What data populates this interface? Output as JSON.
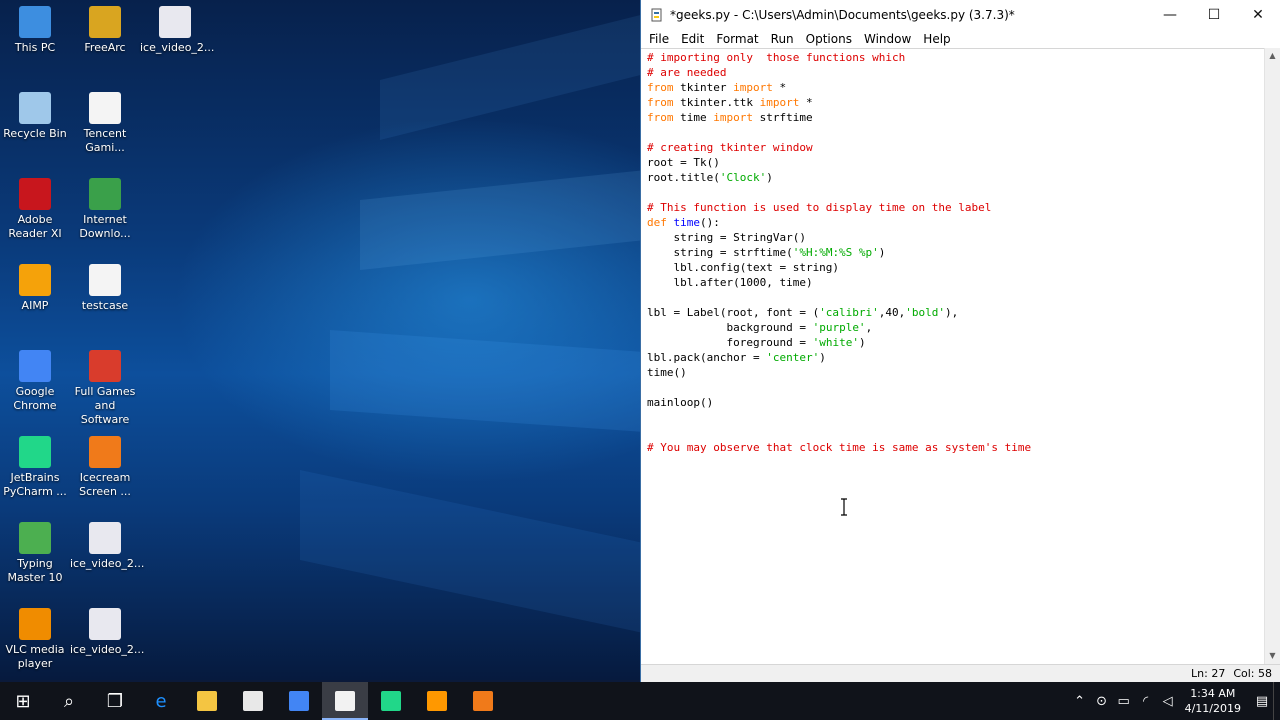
{
  "desktop": {
    "icons": [
      {
        "label": "This PC",
        "icon": "this-pc-icon",
        "color": "#3d8ee0"
      },
      {
        "label": "FreeArc",
        "icon": "freearc-icon",
        "color": "#d9a520"
      },
      {
        "label": "ice_video_2...",
        "icon": "video-file-icon",
        "color": "#e8e8ef"
      },
      {
        "label": "Recycle Bin",
        "icon": "recycle-bin-icon",
        "color": "#9fc8ea"
      },
      {
        "label": "Tencent Gami...",
        "icon": "document-shortcut-icon",
        "color": "#f4f4f4"
      },
      {
        "label": "Adobe Reader XI",
        "icon": "adobe-reader-icon",
        "color": "#c8161d"
      },
      {
        "label": "Internet Downlo...",
        "icon": "internet-download-icon",
        "color": "#3aa04a"
      },
      {
        "label": "AIMP",
        "icon": "aimp-icon",
        "color": "#f5a20a"
      },
      {
        "label": "testcase",
        "icon": "text-file-icon",
        "color": "#f4f4f4"
      },
      {
        "label": "Google Chrome",
        "icon": "chrome-icon",
        "color": "#4285f4"
      },
      {
        "label": "Full Games and Software",
        "icon": "full-games-icon",
        "color": "#d93c2c"
      },
      {
        "label": "JetBrains PyCharm ...",
        "icon": "pycharm-icon",
        "color": "#21d789"
      },
      {
        "label": "Icecream Screen ...",
        "icon": "icecream-icon",
        "color": "#f07a1a"
      },
      {
        "label": "Typing Master 10",
        "icon": "typing-master-icon",
        "color": "#4caf50"
      },
      {
        "label": "ice_video_2...",
        "icon": "video-file-icon",
        "color": "#e8e8ef"
      },
      {
        "label": "VLC media player",
        "icon": "vlc-icon",
        "color": "#f08c00"
      },
      {
        "label": "ice_video_2...",
        "icon": "video-file-icon",
        "color": "#e8e8ef"
      }
    ]
  },
  "window": {
    "title": "*geeks.py - C:\\Users\\Admin\\Documents\\geeks.py (3.7.3)*",
    "controls": {
      "minimize": "—",
      "maximize": "☐",
      "close": "✕"
    },
    "menu": [
      "File",
      "Edit",
      "Format",
      "Run",
      "Options",
      "Window",
      "Help"
    ],
    "code_lines": [
      [
        {
          "t": "# importing only  those functions which",
          "c": "cm"
        }
      ],
      [
        {
          "t": "# are needed",
          "c": "cm"
        }
      ],
      [
        {
          "t": "from",
          "c": "kw"
        },
        {
          "t": " tkinter ",
          "c": ""
        },
        {
          "t": "import",
          "c": "kw"
        },
        {
          "t": " *",
          "c": ""
        }
      ],
      [
        {
          "t": "from",
          "c": "kw"
        },
        {
          "t": " tkinter.ttk ",
          "c": ""
        },
        {
          "t": "import",
          "c": "kw"
        },
        {
          "t": " *",
          "c": ""
        }
      ],
      [
        {
          "t": "from",
          "c": "kw"
        },
        {
          "t": " time ",
          "c": ""
        },
        {
          "t": "import",
          "c": "kw"
        },
        {
          "t": " strftime",
          "c": ""
        }
      ],
      [],
      [
        {
          "t": "# creating tkinter window",
          "c": "cm"
        }
      ],
      [
        {
          "t": "root = Tk()",
          "c": ""
        }
      ],
      [
        {
          "t": "root.title(",
          "c": ""
        },
        {
          "t": "'Clock'",
          "c": "st"
        },
        {
          "t": ")",
          "c": ""
        }
      ],
      [],
      [
        {
          "t": "# This function is used to display time on the label",
          "c": "cm"
        }
      ],
      [
        {
          "t": "def",
          "c": "kw"
        },
        {
          "t": " ",
          "c": ""
        },
        {
          "t": "time",
          "c": "df"
        },
        {
          "t": "():",
          "c": ""
        }
      ],
      [
        {
          "t": "    string = StringVar()",
          "c": ""
        }
      ],
      [
        {
          "t": "    string = strftime(",
          "c": ""
        },
        {
          "t": "'%H:%M:%S %p'",
          "c": "st"
        },
        {
          "t": ")",
          "c": ""
        }
      ],
      [
        {
          "t": "    lbl.config(text = string)",
          "c": ""
        }
      ],
      [
        {
          "t": "    lbl.after(1000, time)",
          "c": ""
        }
      ],
      [],
      [
        {
          "t": "lbl = Label(root, font = (",
          "c": ""
        },
        {
          "t": "'calibri'",
          "c": "st"
        },
        {
          "t": ",40,",
          "c": ""
        },
        {
          "t": "'bold'",
          "c": "st"
        },
        {
          "t": "),",
          "c": ""
        }
      ],
      [
        {
          "t": "            background = ",
          "c": ""
        },
        {
          "t": "'purple'",
          "c": "st"
        },
        {
          "t": ",",
          "c": ""
        }
      ],
      [
        {
          "t": "            foreground = ",
          "c": ""
        },
        {
          "t": "'white'",
          "c": "st"
        },
        {
          "t": ")",
          "c": ""
        }
      ],
      [
        {
          "t": "lbl.pack(anchor = ",
          "c": ""
        },
        {
          "t": "'center'",
          "c": "st"
        },
        {
          "t": ")",
          "c": ""
        }
      ],
      [
        {
          "t": "time()",
          "c": ""
        }
      ],
      [],
      [
        {
          "t": "mainloop()",
          "c": ""
        }
      ],
      [],
      [],
      [
        {
          "t": "# You may observe that clock time is same as system's time",
          "c": "cm"
        }
      ]
    ],
    "status": {
      "line": "Ln: 27",
      "col": "Col: 58"
    }
  },
  "taskbar": {
    "apps": [
      {
        "name": "start-button",
        "icon": "windows-start-icon",
        "glyph": "⊞",
        "color": "#ffffff"
      },
      {
        "name": "search-button",
        "icon": "search-icon",
        "glyph": "⌕",
        "color": "#ffffff"
      },
      {
        "name": "task-view-button",
        "icon": "task-view-icon",
        "glyph": "❐",
        "color": "#ffffff"
      },
      {
        "name": "edge-button",
        "icon": "edge-icon",
        "glyph": "e",
        "color": "#1e90ff"
      },
      {
        "name": "file-explorer-button",
        "icon": "folder-icon",
        "glyph": "",
        "color": "#f4c542"
      },
      {
        "name": "store-button",
        "icon": "store-icon",
        "glyph": "",
        "color": "#e8e8e8"
      },
      {
        "name": "chrome-button",
        "icon": "chrome-icon",
        "glyph": "",
        "color": "#4285f4"
      },
      {
        "name": "idle-button",
        "icon": "python-idle-icon",
        "glyph": "",
        "color": "#f2f2f2",
        "active": true
      },
      {
        "name": "pycharm-button",
        "icon": "pycharm-icon",
        "glyph": "",
        "color": "#21d789"
      },
      {
        "name": "sublime-button",
        "icon": "sublime-icon",
        "glyph": "",
        "color": "#ff9800"
      },
      {
        "name": "icecream-button",
        "icon": "icecream-icon",
        "glyph": "",
        "color": "#f07a1a"
      }
    ],
    "tray": {
      "icons": [
        "chevron-up-icon",
        "network-monitor-icon",
        "battery-icon",
        "wifi-icon",
        "volume-icon",
        "notification-icon"
      ],
      "time": "1:34 AM",
      "date": "4/11/2019"
    }
  }
}
